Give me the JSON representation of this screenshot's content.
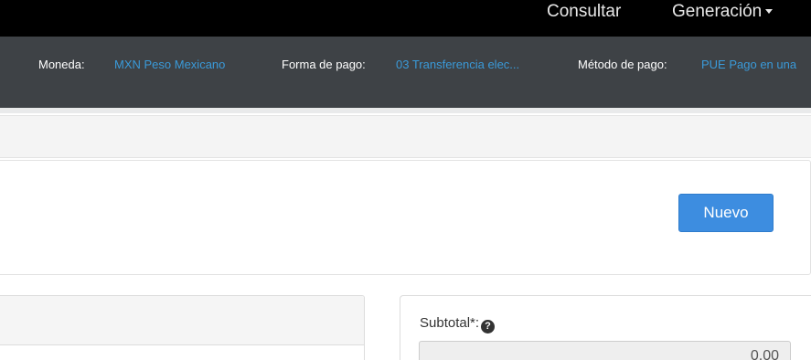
{
  "topnav": {
    "consultar_label": "Consultar",
    "generacion_label": "Generación"
  },
  "infobar": {
    "moneda_label": "Moneda:",
    "moneda_value": "MXN Peso Mexicano",
    "forma_pago_label": "Forma de pago:",
    "forma_pago_value": "03 Transferencia elec...",
    "metodo_pago_label": "Método de pago:",
    "metodo_pago_value": "PUE Pago en una"
  },
  "actions": {
    "nuevo_label": "Nuevo"
  },
  "totals": {
    "subtotal_label": "Subtotal*:",
    "subtotal_help_icon": "?",
    "subtotal_value": "0.00"
  },
  "colors": {
    "topbar_bg": "#000000",
    "infobar_bg": "#3e4246",
    "link_blue": "#3a9ad9",
    "button_blue": "#3d8de0"
  },
  "icons": {
    "generacion_dropdown": "caret-down-icon",
    "subtotal_help": "question-circle-icon"
  }
}
